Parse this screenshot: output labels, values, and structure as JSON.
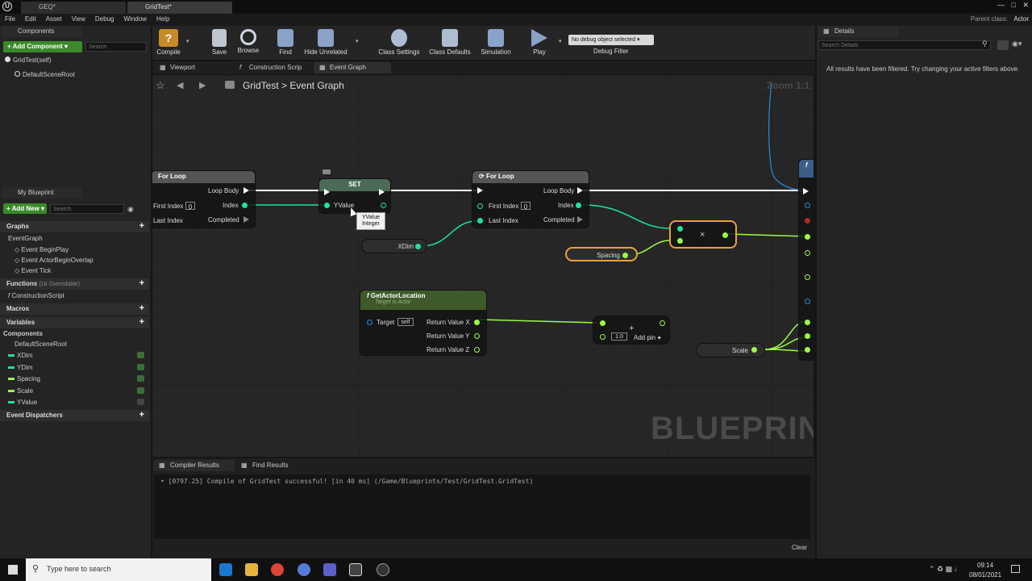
{
  "window": {
    "tabs": [
      "GEQ*",
      "GridTest*"
    ],
    "parent_class_label": "Parent class:",
    "parent_class_value": "Actor"
  },
  "menu": [
    "File",
    "Edit",
    "Asset",
    "View",
    "Debug",
    "Window",
    "Help"
  ],
  "components_panel": {
    "tab": "Components",
    "add_button": "+ Add Component",
    "search_placeholder": "Search",
    "items": [
      "GridTest(self)",
      "DefaultSceneRoot"
    ]
  },
  "my_blueprint": {
    "tab": "My Blueprint",
    "add_button": "+ Add New",
    "search_placeholder": "Search",
    "graphs_header": "Graphs",
    "graph_items": [
      "EventGraph",
      "Event BeginPlay",
      "Event ActorBeginOverlap",
      "Event Tick"
    ],
    "functions_header": "Functions",
    "functions_note": "(18 Overridable)",
    "function_items": [
      "ConstructionScript"
    ],
    "macros_header": "Macros",
    "variables_header": "Variables",
    "components_header": "Components",
    "component_items": [
      "DefaultSceneRoot"
    ],
    "variable_items": [
      "XDim",
      "YDim",
      "Spacing",
      "Scale",
      "YValue"
    ],
    "dispatchers_header": "Event Dispatchers"
  },
  "toolbar": {
    "compile": "Compile",
    "save": "Save",
    "browse": "Browse",
    "find": "Find",
    "hide_unrelated": "Hide Unrelated",
    "class_settings": "Class Settings",
    "class_defaults": "Class Defaults",
    "simulation": "Simulation",
    "play": "Play",
    "debug_select": "No debug object selected",
    "debug_filter": "Debug Filter"
  },
  "graph_tabs": [
    "Viewport",
    "Construction Scrip",
    "Event Graph"
  ],
  "graph": {
    "breadcrumb_root": "GridTest",
    "breadcrumb_sep": ">",
    "breadcrumb_leaf": "Event Graph",
    "zoom": "Zoom 1:1",
    "watermark": "BLUEPRINT",
    "tooltip_name": "YValue",
    "tooltip_type": "Integer",
    "nodes": {
      "forloop1": {
        "title": "For Loop",
        "first_index": "First Index",
        "first_index_val": "0",
        "last_index": "Last Index",
        "loop_body": "Loop Body",
        "index": "Index",
        "completed": "Completed"
      },
      "set": {
        "title": "SET",
        "pin": "YValue"
      },
      "xdim": "XDim",
      "forloop2": {
        "title": "For Loop",
        "first_index": "First Index",
        "first_index_val": "0",
        "last_index": "Last Index",
        "loop_body": "Loop Body",
        "index": "Index",
        "completed": "Completed"
      },
      "multiply": "×",
      "spacing": "Spacing",
      "getactor": {
        "title": "GetActorLocation",
        "subtitle": "Target is Actor",
        "target": "Target",
        "target_val": "self",
        "rx": "Return Value X",
        "ry": "Return Value Y",
        "rz": "Return Value Z"
      },
      "add": {
        "value": "1.0",
        "add_pin": "Add pin",
        "plus": "+"
      },
      "scale": "Scale"
    }
  },
  "bottom": {
    "tabs": [
      "Compiler Results",
      "Find Results"
    ],
    "log_line": "[0797.25] Compile of GridTest successful! [in 40 ms] (/Game/Blueprints/Test/GridTest.GridTest)",
    "clear": "Clear"
  },
  "details": {
    "tab": "Details",
    "search_placeholder": "Search Details",
    "message": "All results have been filtered. Try changing your active filters above."
  },
  "taskbar": {
    "search_placeholder": "Type here to search",
    "time": "09:14",
    "date": "08/01/2021"
  },
  "colors": {
    "exec": "#ffffff",
    "int_pin": "#1fe0a6",
    "float_pin": "#9cf94a",
    "forloop_head": "#555555",
    "set_head": "#4b6b57",
    "func_head": "#3f5a2a",
    "add_component": "#3a8a2a",
    "selection": "#e8a23a"
  }
}
